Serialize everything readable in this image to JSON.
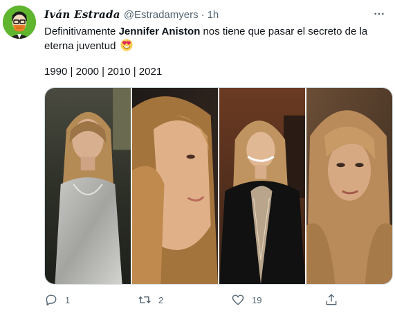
{
  "tweet": {
    "display_name": "Iván Estrada",
    "handle": "@Estradamyers",
    "separator": "·",
    "time": "1h",
    "text_before": "Definitivamente ",
    "text_bold": "Jennifer Aniston",
    "text_after": " nos tiene que pasar el secreto de la eterna juventud",
    "emoji": "heart-eyes-emoji",
    "years_line": "1990 | 2000 | 2010 | 2021"
  },
  "media": {
    "photos": [
      {
        "name": "photo-1990"
      },
      {
        "name": "photo-2000"
      },
      {
        "name": "photo-2010"
      },
      {
        "name": "photo-2021"
      }
    ]
  },
  "actions": {
    "reply_count": "1",
    "retweet_count": "2",
    "like_count": "19",
    "reply_icon": "reply-icon",
    "retweet_icon": "retweet-icon",
    "like_icon": "heart-icon",
    "share_icon": "share-icon"
  },
  "colors": {
    "text_primary": "#0f1419",
    "text_secondary": "#536471",
    "border": "#cfd9de",
    "avatar_bg": "#5fb52e"
  }
}
